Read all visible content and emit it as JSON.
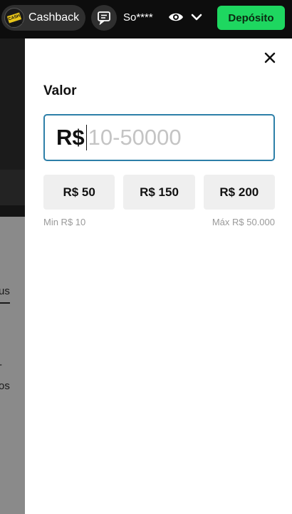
{
  "header": {
    "cashback_label": "Cashback",
    "cashback_logo_text": "CASH BACK",
    "username": "So****",
    "deposit_label": "Depósito"
  },
  "background": {
    "partial_text_1": "us",
    "partial_text_2": "-",
    "partial_text_3": "os"
  },
  "panel": {
    "title": "Valor",
    "currency_symbol": "R$",
    "amount_value": "",
    "amount_placeholder": "10-50000",
    "quick_amounts": [
      "R$ 50",
      "R$ 150",
      "R$ 200"
    ],
    "min_label": "Min R$ 10",
    "max_label": "Máx R$ 50.000"
  },
  "colors": {
    "deposit_button": "#1ed760",
    "input_border": "#2d7fa8",
    "chip_background": "#efefef"
  },
  "icons": [
    "cashback-logo-icon",
    "chat-icon",
    "eye-icon",
    "chevron-down-icon",
    "close-icon"
  ]
}
